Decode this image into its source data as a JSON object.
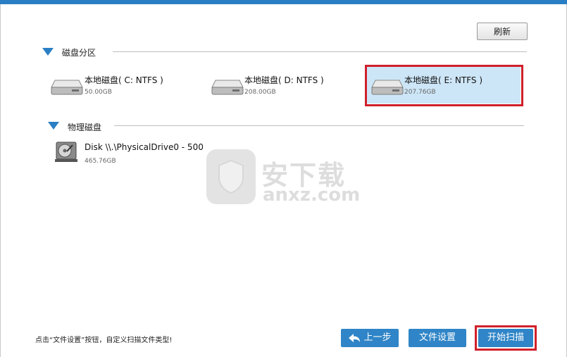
{
  "toolbar": {
    "refresh_label": "刷新"
  },
  "partitions": {
    "label": "磁盘分区",
    "drives": [
      {
        "name": "本地磁盘( C: NTFS )",
        "size": "50.00GB",
        "icon": "hdd-icon",
        "selected": false
      },
      {
        "name": "本地磁盘( D: NTFS )",
        "size": "208.00GB",
        "icon": "hdd-icon",
        "selected": false
      },
      {
        "name": "本地磁盘( E: NTFS )",
        "size": "207.76GB",
        "icon": "hdd-icon",
        "selected": true
      }
    ]
  },
  "physical": {
    "label": "物理磁盘",
    "disks": [
      {
        "name": "Disk \\\\.\\PhysicalDrive0 - 500",
        "size": "465.76GB",
        "icon": "physical-disk-icon"
      }
    ]
  },
  "watermark": {
    "cn": "安下载",
    "en": "anxz.com"
  },
  "footer": {
    "hint": "点击“文件设置”按钮，自定义扫描文件类型!",
    "back_label": "上一步",
    "settings_label": "文件设置",
    "start_label": "开始扫描"
  },
  "colors": {
    "accent": "#2f85c7",
    "highlight": "#d0202a",
    "selection": "#cde6f7"
  }
}
